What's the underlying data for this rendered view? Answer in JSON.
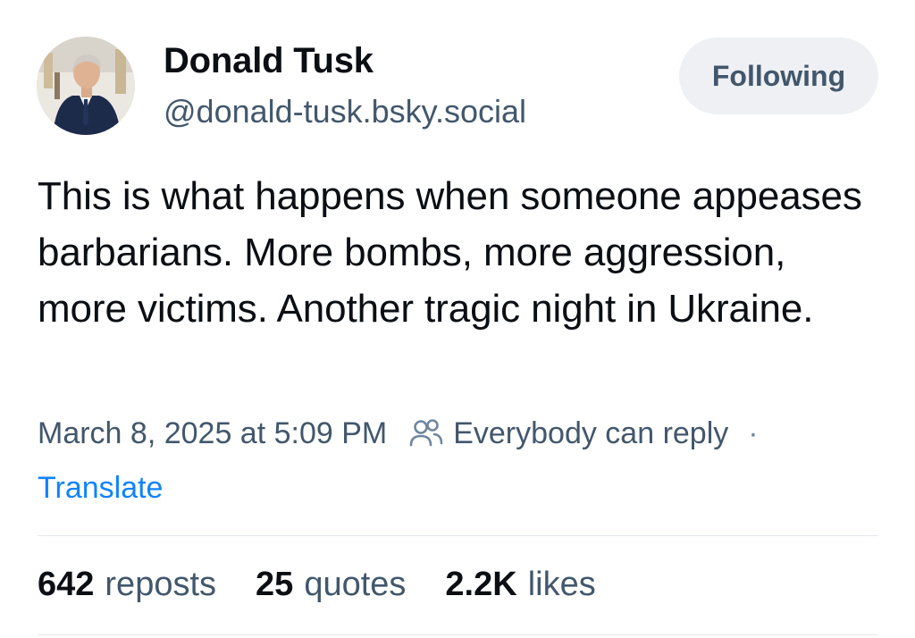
{
  "author": {
    "display_name": "Donald Tusk",
    "handle": "@donald-tusk.bsky.social",
    "avatar_icon": "avatar-photo"
  },
  "follow_button": {
    "label": "Following"
  },
  "post": {
    "text": "This is what happens when someone appeases barbarians. More bombs, more aggression, more victims. Another tragic night in Ukraine."
  },
  "meta": {
    "timestamp": "March 8, 2025 at 5:09 PM",
    "reply_setting_icon": "people-icon",
    "reply_setting": "Everybody can reply",
    "separator": "·",
    "translate_label": "Translate"
  },
  "stats": {
    "reposts_count": "642",
    "reposts_label": "reposts",
    "quotes_count": "25",
    "quotes_label": "quotes",
    "likes_count": "2.2K",
    "likes_label": "likes"
  },
  "colors": {
    "text_primary": "#0b0f14",
    "text_secondary": "#42576c",
    "link": "#1083fe",
    "button_bg": "#eef0f3",
    "divider": "#e3e7ec"
  }
}
